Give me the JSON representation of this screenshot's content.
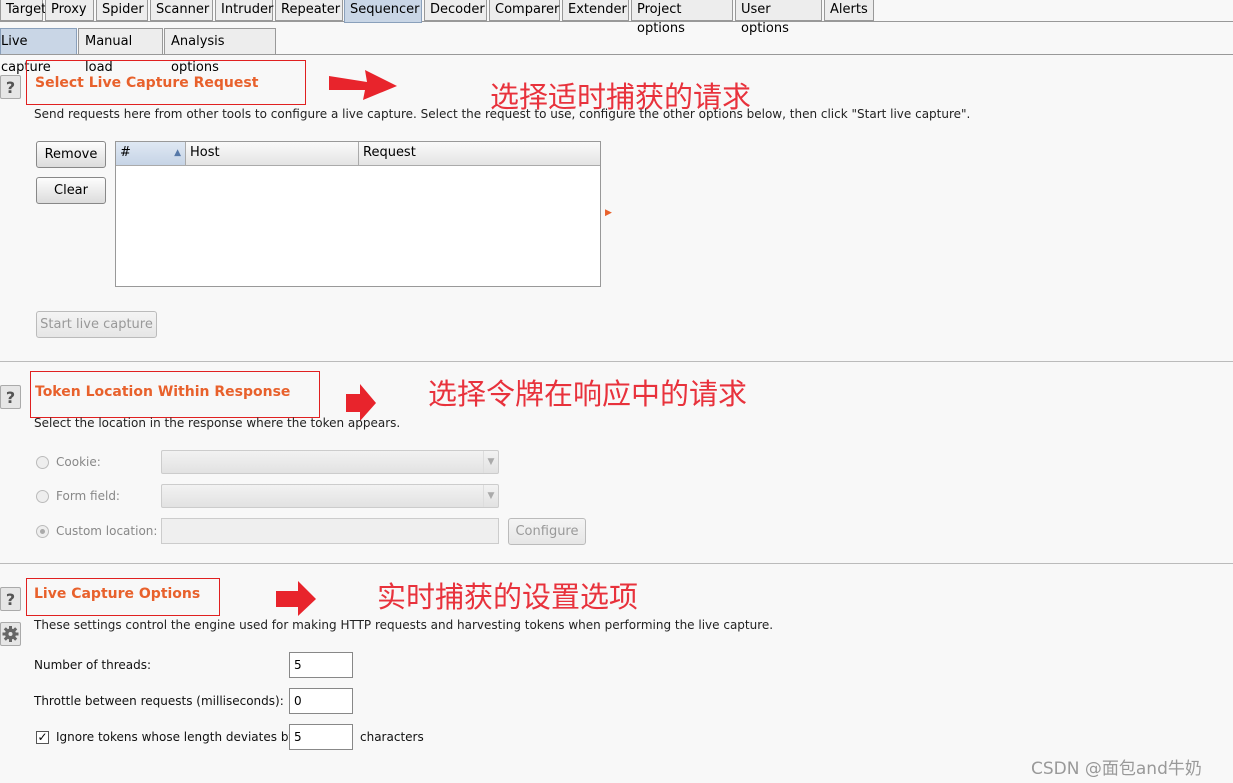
{
  "main_tabs": [
    "Target",
    "Proxy",
    "Spider",
    "Scanner",
    "Intruder",
    "Repeater",
    "Sequencer",
    "Decoder",
    "Comparer",
    "Extender",
    "Project options",
    "User options",
    "Alerts"
  ],
  "sub_tabs": [
    "Live capture",
    "Manual load",
    "Analysis options"
  ],
  "help_glyph": "?",
  "section1": {
    "title": "Select Live Capture Request",
    "description": "Send requests here from other tools to configure a live capture. Select the request to use, configure the other options below, then click \"Start live capture\".",
    "remove_label": "Remove",
    "clear_label": "Clear",
    "columns": [
      "#",
      "Host",
      "Request"
    ],
    "sort_glyph": "▲",
    "expand_glyph": "▶",
    "start_label": "Start live capture",
    "annotation": "选择适时捕获的请求"
  },
  "section2": {
    "title": "Token Location Within Response",
    "description": "Select the location in the response where the token appears.",
    "cookie_label": "Cookie:",
    "formfield_label": "Form field:",
    "custom_label": "Custom location:",
    "configure_label": "Configure",
    "dropdown_glyph": "▼",
    "annotation": "选择令牌在响应中的请求"
  },
  "section3": {
    "title": "Live Capture Options",
    "description": "These settings control the engine used for making HTTP requests and harvesting tokens when performing the live capture.",
    "threads_label": "Number of threads:",
    "threads_value": "5",
    "throttle_label": "Throttle between requests (milliseconds):",
    "throttle_value": "0",
    "ignore_label": "Ignore tokens whose length deviates by",
    "ignore_value": "5",
    "ignore_suffix": "characters",
    "ignore_checked": true,
    "check_glyph": "✓",
    "annotation": "实时捕获的设置选项"
  },
  "watermark": "CSDN @面包and牛奶",
  "colors": {
    "section_title": "#e8612c",
    "annotation": "#e8323c",
    "active_tab": "#c9d6e6"
  }
}
